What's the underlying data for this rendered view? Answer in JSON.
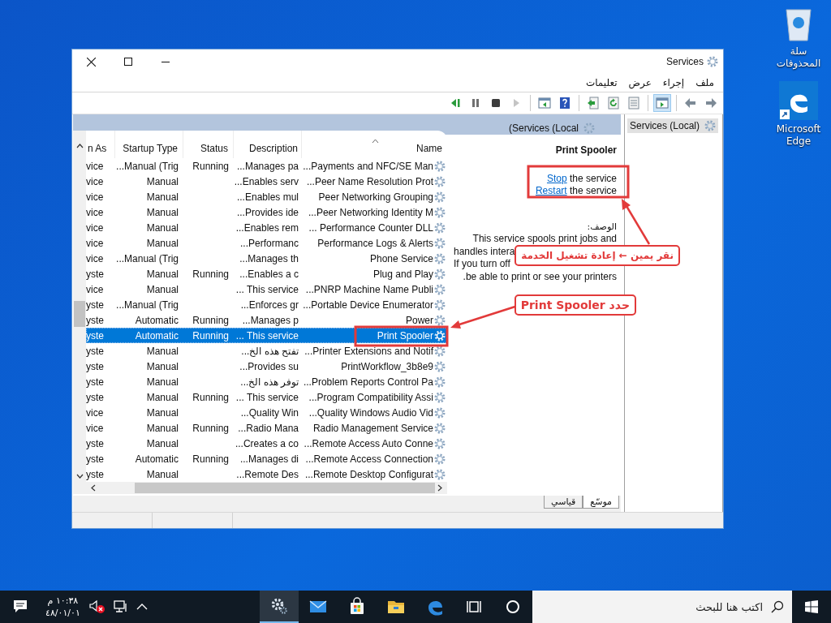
{
  "desktop_icons": [
    {
      "kind": "recycle",
      "label": "سلة المحذوفات"
    },
    {
      "kind": "edge",
      "label": "Microsoft Edge"
    }
  ],
  "window": {
    "title": "Services",
    "menu": [
      "ملف",
      "إجراء",
      "عرض",
      "تعليمات"
    ]
  },
  "toolbar": [
    [
      {
        "kind": "forward",
        "on": false,
        "disabled": false
      },
      {
        "kind": "back",
        "on": false,
        "disabled": false
      }
    ],
    [
      {
        "kind": "pane",
        "on": true,
        "disabled": false
      }
    ],
    [
      {
        "kind": "sheet",
        "on": false,
        "disabled": false
      },
      {
        "kind": "refresh",
        "on": false,
        "disabled": false
      },
      {
        "kind": "export",
        "on": false,
        "disabled": false
      }
    ],
    [
      {
        "kind": "help",
        "on": false,
        "disabled": false
      },
      {
        "kind": "props",
        "on": false,
        "disabled": false
      }
    ],
    [
      {
        "kind": "start",
        "on": false,
        "disabled": true
      },
      {
        "kind": "stop",
        "on": false,
        "disabled": false
      },
      {
        "kind": "pause",
        "on": false,
        "disabled": false
      },
      {
        "kind": "restart",
        "on": false,
        "disabled": false
      }
    ]
  ],
  "details": {
    "header": "(Services (Local",
    "table": {
      "columns": [
        {
          "label": "n As",
          "sorted": false
        },
        {
          "label": "Startup Type",
          "sorted": false
        },
        {
          "label": "Status",
          "sorted": false
        },
        {
          "label": "Description",
          "sorted": false
        },
        {
          "label": "Name",
          "sorted": true
        }
      ],
      "rows": [
        {
          "log_on": "vice",
          "startup": "...Manual (Trig",
          "status": "Running",
          "description": "...Manages pa",
          "name": "...Payments and NFC/SE Man",
          "selected": false
        },
        {
          "log_on": "vice",
          "startup": "Manual",
          "description": "...Enables serv",
          "name": "...Peer Name Resolution Prot",
          "selected": false
        },
        {
          "log_on": "vice",
          "startup": "Manual",
          "description": "...Enables mul",
          "name": "Peer Networking Grouping",
          "selected": false
        },
        {
          "log_on": "vice",
          "startup": "Manual",
          "description": "...Provides ide",
          "name": "...Peer Networking Identity M",
          "selected": false
        },
        {
          "log_on": "vice",
          "startup": "Manual",
          "description": "...Enables rem",
          "name": "... Performance Counter DLL",
          "selected": false
        },
        {
          "log_on": "vice",
          "startup": "Manual",
          "description": "...Performanc",
          "name": "Performance Logs & Alerts",
          "selected": false
        },
        {
          "log_on": "vice",
          "startup": "...Manual (Trig",
          "description": "...Manages th",
          "name": "Phone Service",
          "selected": false
        },
        {
          "log_on": "yste",
          "startup": "Manual",
          "status": "Running",
          "description": "...Enables a c",
          "name": "Plug and Play",
          "selected": false
        },
        {
          "log_on": "vice",
          "startup": "Manual",
          "description": "... This service",
          "name": "...PNRP Machine Name Publi",
          "selected": false
        },
        {
          "log_on": "yste",
          "startup": "...Manual (Trig",
          "description": "...Enforces gr",
          "name": "...Portable Device Enumerator",
          "selected": false
        },
        {
          "log_on": "yste",
          "startup": "Automatic",
          "status": "Running",
          "description": "...Manages p",
          "name": "Power",
          "selected": false
        },
        {
          "log_on": "yste",
          "startup": "Automatic",
          "status": "Running",
          "description": "... This service",
          "name": "Print Spooler",
          "selected": true
        },
        {
          "log_on": "yste",
          "startup": "Manual",
          "description": "تفتح هذه الخ...",
          "name": "...Printer Extensions and Notif",
          "selected": false
        },
        {
          "log_on": "yste",
          "startup": "Manual",
          "description": "...Provides su",
          "name": "PrintWorkflow_3b8e9",
          "selected": false
        },
        {
          "log_on": "yste",
          "startup": "Manual",
          "description": "توفر هذه الخ...",
          "name": "...Problem Reports Control Pa",
          "selected": false
        },
        {
          "log_on": "yste",
          "startup": "Manual",
          "status": "Running",
          "description": "... This service",
          "name": "...Program Compatibility Assi",
          "selected": false
        },
        {
          "log_on": "vice",
          "startup": "Manual",
          "description": "...Quality Win",
          "name": "...Quality Windows Audio Vid",
          "selected": false
        },
        {
          "log_on": "vice",
          "startup": "Manual",
          "status": "Running",
          "description": "...Radio Mana",
          "name": "Radio Management Service",
          "selected": false
        },
        {
          "log_on": "yste",
          "startup": "Manual",
          "description": "...Creates a co",
          "name": "...Remote Access Auto Conne",
          "selected": false
        },
        {
          "log_on": "yste",
          "startup": "Automatic",
          "status": "Running",
          "description": "...Manages di",
          "name": "...Remote Access Connection",
          "selected": false
        },
        {
          "log_on": "yste",
          "startup": "Manual",
          "description": "...Remote Des",
          "name": "...Remote Desktop Configurat",
          "selected": false
        }
      ]
    },
    "info": {
      "title": "Print Spooler",
      "actions": [
        {
          "link": "Stop",
          "text": " the service"
        },
        {
          "link": "Restart",
          "text": " the service"
        }
      ],
      "description_label": "الوصف:",
      "description_lines": [
        "This service spools print jobs and",
        "handles intera",
        "If you turn off",
        ".be able to print or see your printers"
      ]
    },
    "view_tabs": [
      {
        "label": "موسّع",
        "selected": true
      },
      {
        "label": "قياسي",
        "selected": false
      }
    ]
  },
  "tree": {
    "items": [
      {
        "label": "Services (Local)",
        "selected": true
      }
    ]
  },
  "callouts": [
    {
      "text": "نقر يمين ← إعادة تشغيل الخدمة"
    },
    {
      "text": "حدد Print Spooler"
    }
  ],
  "taskbar": {
    "search": {
      "placeholder": "اكتب هنا للبحث"
    },
    "apps": [
      {
        "kind": "cortana",
        "active": false
      },
      {
        "kind": "taskview",
        "active": false
      },
      {
        "kind": "edge",
        "active": false
      },
      {
        "kind": "explorer",
        "active": false
      },
      {
        "kind": "store",
        "active": false
      },
      {
        "kind": "mail",
        "active": false
      },
      {
        "kind": "services",
        "active": true
      }
    ],
    "clock": {
      "time": "١٠:٣٨ م",
      "date": "٤٨/٠١/٠١"
    }
  }
}
